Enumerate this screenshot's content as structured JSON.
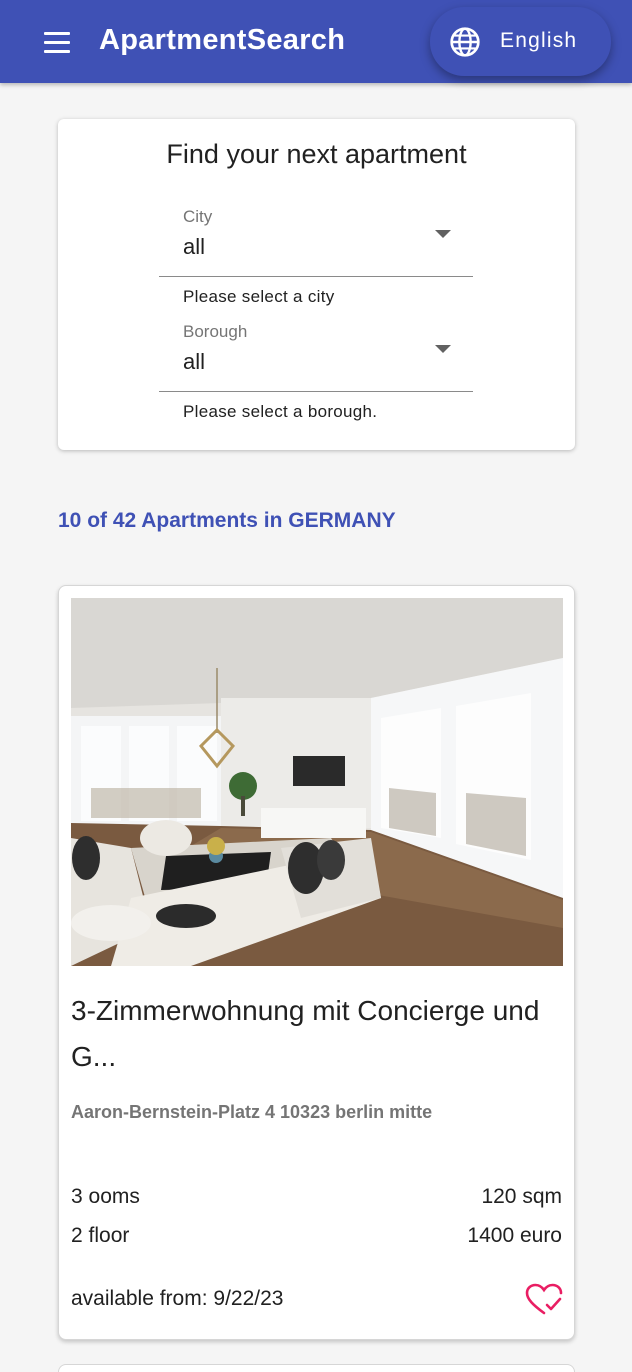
{
  "app": {
    "title": "ApartmentSearch",
    "language": "English"
  },
  "search": {
    "heading": "Find your next apartment",
    "city": {
      "label": "City",
      "value": "all",
      "helper": "Please select a city"
    },
    "borough": {
      "label": "Borough",
      "value": "all",
      "helper": "Please select a borough."
    }
  },
  "results": {
    "summary": "10 of 42 Apartments in GERMANY"
  },
  "listing": {
    "title": "3-Zimmerwohnung mit Concierge und G...",
    "address": "Aaron-Bernstein-Platz 4 10323 berlin mitte",
    "rooms": "3 ooms",
    "area": "120 sqm",
    "floor": "2 floor",
    "price": "1400 euro",
    "available": "available from: 9/22/23"
  },
  "colors": {
    "primary": "#3f51b5",
    "favorite": "#e91e63"
  },
  "icons": {
    "menu": "menu-icon",
    "language": "globe-icon",
    "favorite": "heart-check-icon"
  }
}
